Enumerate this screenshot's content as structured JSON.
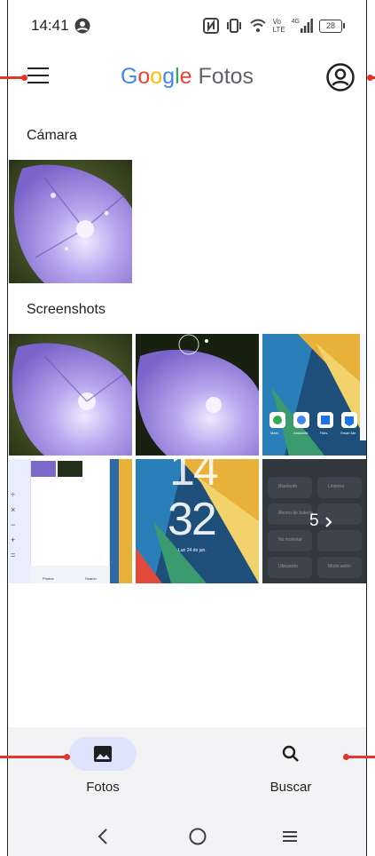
{
  "status": {
    "time": "14:41",
    "battery": "28",
    "network_vo": "Vo",
    "network_lte": "LTE",
    "network_4g": "4G"
  },
  "header": {
    "brand_letters": [
      "G",
      "o",
      "o",
      "g",
      "l",
      "e"
    ],
    "brand_suffix": "Fotos"
  },
  "sections": {
    "camera_title": "Cámara",
    "screenshots_title": "Screenshots"
  },
  "thumbnails": {
    "lockscreen_hour": "14",
    "lockscreen_minute": "32",
    "lockscreen_date": "Lun 24 de jun.",
    "quick_settings_count": "5",
    "quick_settings_tiles": [
      "Bluetooth",
      "Linterna",
      "Ahorro de batería",
      "No molestar",
      "Ubicación",
      "Modo avión"
    ],
    "calculator_keys": [
      "÷",
      "×",
      "−",
      "+",
      "="
    ],
    "mini_nav_labels": [
      "Photos",
      "Search"
    ],
    "app_shortcuts": [
      "Meet",
      "Asistente",
      "Files",
      "Smart Me"
    ]
  },
  "bottom_nav": {
    "photos_label": "Fotos",
    "search_label": "Buscar"
  },
  "colors": {
    "accent_pill": "#dce3fb",
    "callout": "#e5352b",
    "nav_bg": "#f3f3f6"
  }
}
